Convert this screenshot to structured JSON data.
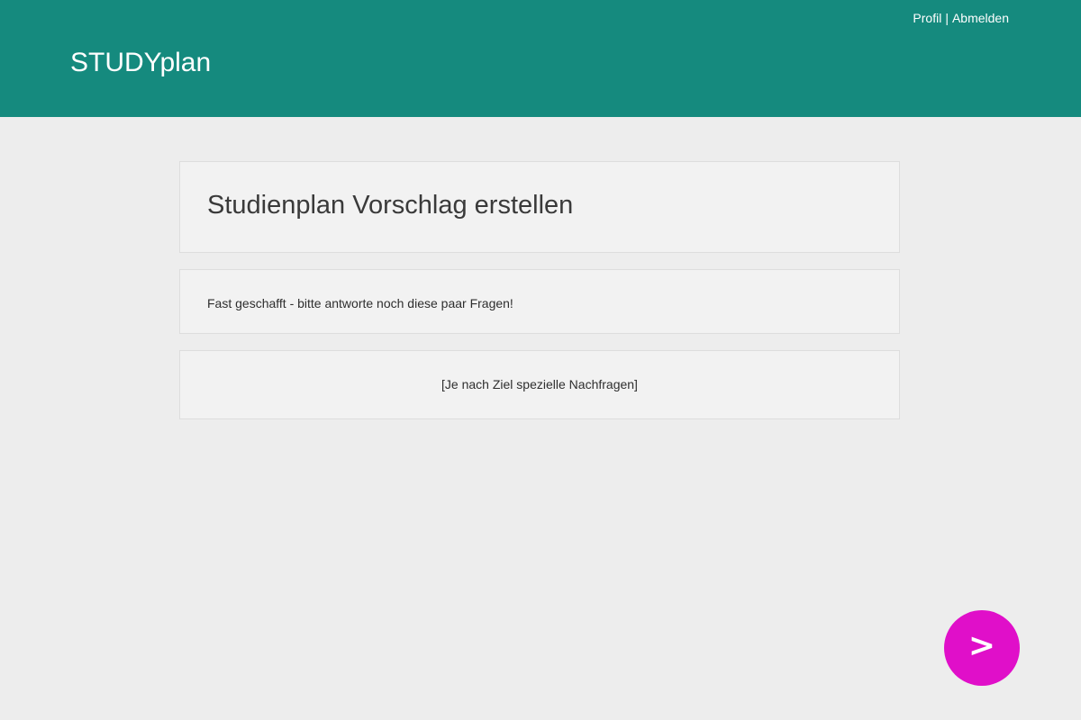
{
  "header": {
    "brand": "STUDYplan",
    "links": {
      "profile": "Profil",
      "separator": "|",
      "logout": "Abmelden"
    }
  },
  "main": {
    "title": "Studienplan Vorschlag erstellen",
    "info": "Fast geschafft - bitte antworte noch diese paar Fragen!",
    "questions_placeholder": "[Je nach Ziel spezielle Nachfragen]"
  },
  "next_button": {
    "label": ">",
    "icon": "chevron-right-icon"
  },
  "colors": {
    "header_background": "#158a7e",
    "page_background": "#ededed",
    "panel_background": "#f2f2f2",
    "accent_button": "#e00fc9"
  }
}
